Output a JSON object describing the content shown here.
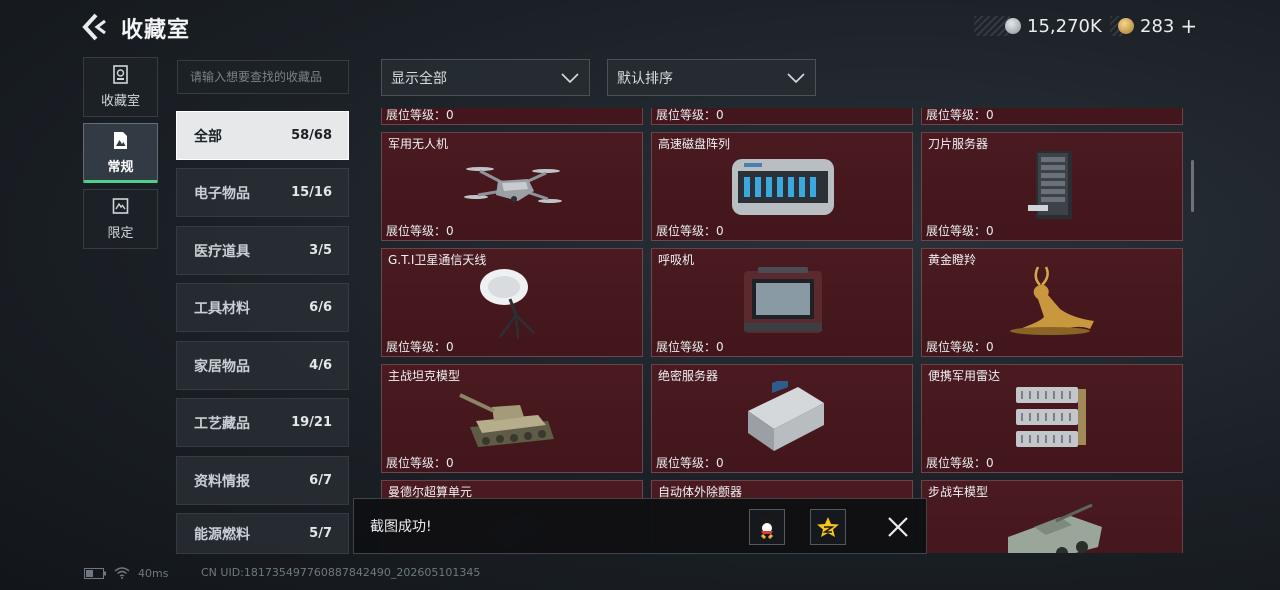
{
  "header": {
    "title": "收藏室",
    "currencies": [
      {
        "value": "15,270K",
        "icon": "silver-coin-icon",
        "color": "#aeb6bd"
      },
      {
        "value": "283",
        "suffix": "+",
        "icon": "gold-coin-icon",
        "color": "#d6a64a"
      }
    ]
  },
  "mode_tabs": [
    {
      "label": "收藏室",
      "icon": "collection-icon"
    },
    {
      "label": "常规",
      "icon": "regular-icon",
      "active": true
    },
    {
      "label": "限定",
      "icon": "limited-icon"
    }
  ],
  "search": {
    "placeholder": "请输入想要查找的收藏品"
  },
  "categories": [
    {
      "label": "全部",
      "count": "58/68",
      "active": true
    },
    {
      "label": "电子物品",
      "count": "15/16"
    },
    {
      "label": "医疗道具",
      "count": "3/5"
    },
    {
      "label": "工具材料",
      "count": "6/6"
    },
    {
      "label": "家居物品",
      "count": "4/6"
    },
    {
      "label": "工艺藏品",
      "count": "19/21"
    },
    {
      "label": "资料情报",
      "count": "6/7"
    },
    {
      "label": "能源燃料",
      "count": "5/7"
    }
  ],
  "filters": {
    "display": "显示全部",
    "sort": "默认排序"
  },
  "level_prefix": "展位等级：",
  "items": [
    {
      "name": "",
      "level": "0",
      "icon": "item-icon"
    },
    {
      "name": "",
      "level": "0",
      "icon": "item-icon"
    },
    {
      "name": "",
      "level": "0",
      "icon": "item-icon"
    },
    {
      "name": "军用无人机",
      "level": "0",
      "icon": "drone-icon"
    },
    {
      "name": "高速磁盘阵列",
      "level": "0",
      "icon": "disk-array-icon"
    },
    {
      "name": "刀片服务器",
      "level": "0",
      "icon": "blade-server-icon"
    },
    {
      "name": "G.T.I卫星通信天线",
      "level": "0",
      "icon": "satellite-antenna-icon"
    },
    {
      "name": "呼吸机",
      "level": "0",
      "icon": "ventilator-icon"
    },
    {
      "name": "黄金瞪羚",
      "level": "0",
      "icon": "gold-gazelle-icon"
    },
    {
      "name": "主战坦克模型",
      "level": "0",
      "icon": "tank-model-icon"
    },
    {
      "name": "绝密服务器",
      "level": "0",
      "icon": "secret-server-icon"
    },
    {
      "name": "便携军用雷达",
      "level": "0",
      "icon": "portable-radar-icon"
    },
    {
      "name": "曼德尔超算单元",
      "level": "",
      "icon": "supercomputer-icon"
    },
    {
      "name": "自动体外除颤器",
      "level": "",
      "icon": "defibrillator-icon"
    },
    {
      "name": "步战车模型",
      "level": "",
      "icon": "ifv-model-icon"
    }
  ],
  "toast": {
    "message": "截图成功!",
    "share_icons": [
      "qq-icon",
      "qzone-icon"
    ]
  },
  "status": {
    "ping": "40ms",
    "uid": "CN UID:1817354977608878424​90_202605101345"
  }
}
